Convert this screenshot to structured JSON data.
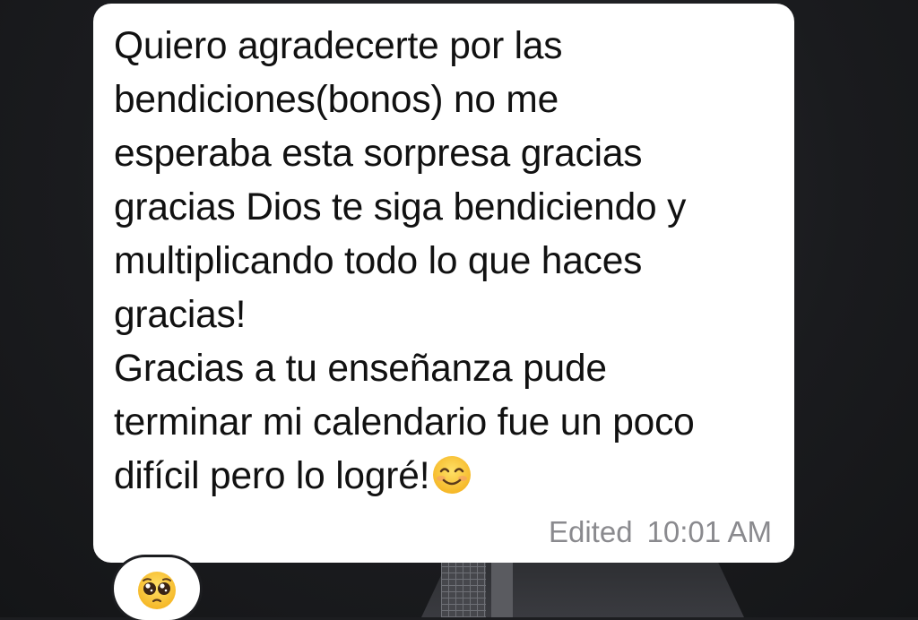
{
  "message": {
    "text": "Quiero agradecerte por las\nbendiciones(bonos) no me\nesperaba esta sorpresa gracias\ngracias Dios te siga bendiciendo y\nmultiplicando todo lo que haces\ngracias!\nGracias a tu enseñanza pude\nterminar mi calendario fue un poco\ndifícil pero lo logré!",
    "trailing_emoji": "smiling-face-with-smiling-eyes",
    "edited_label": "Edited",
    "time": "10:01 AM"
  },
  "reaction": {
    "emoji": "pleading-face"
  },
  "colors": {
    "bubble": "#ffffff",
    "text": "#111111",
    "meta": "#8a8a8e",
    "background": "#1c1d20"
  }
}
